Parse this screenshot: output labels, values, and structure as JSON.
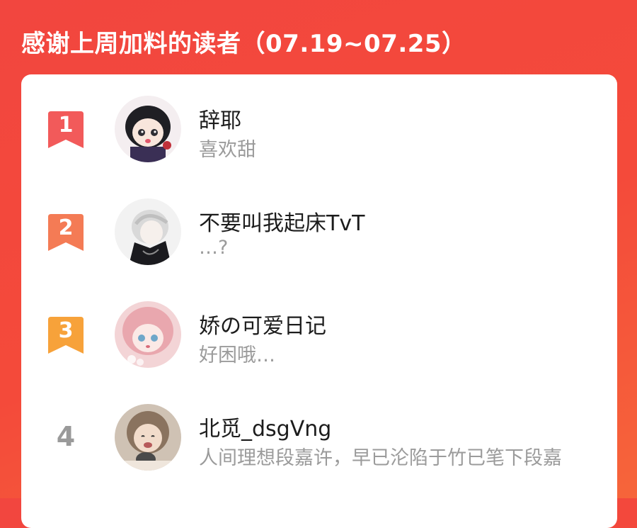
{
  "header": {
    "title": "感谢上周加料的读者（07.19~07.25）"
  },
  "readers": [
    {
      "rank": "1",
      "name": "辞耶",
      "note": "喜欢甜",
      "badge_color": "#f25a5a"
    },
    {
      "rank": "2",
      "name": "不要叫我起床TvT",
      "note": "…?",
      "badge_color": "#f47b55"
    },
    {
      "rank": "3",
      "name": "娇の可爱日记",
      "note": "好困哦…",
      "badge_color": "#f7a23a"
    },
    {
      "rank": "4",
      "name": "北觅_dsgVng",
      "note": "人间理想段嘉许，早已沦陷于竹已笔下段嘉"
    }
  ]
}
